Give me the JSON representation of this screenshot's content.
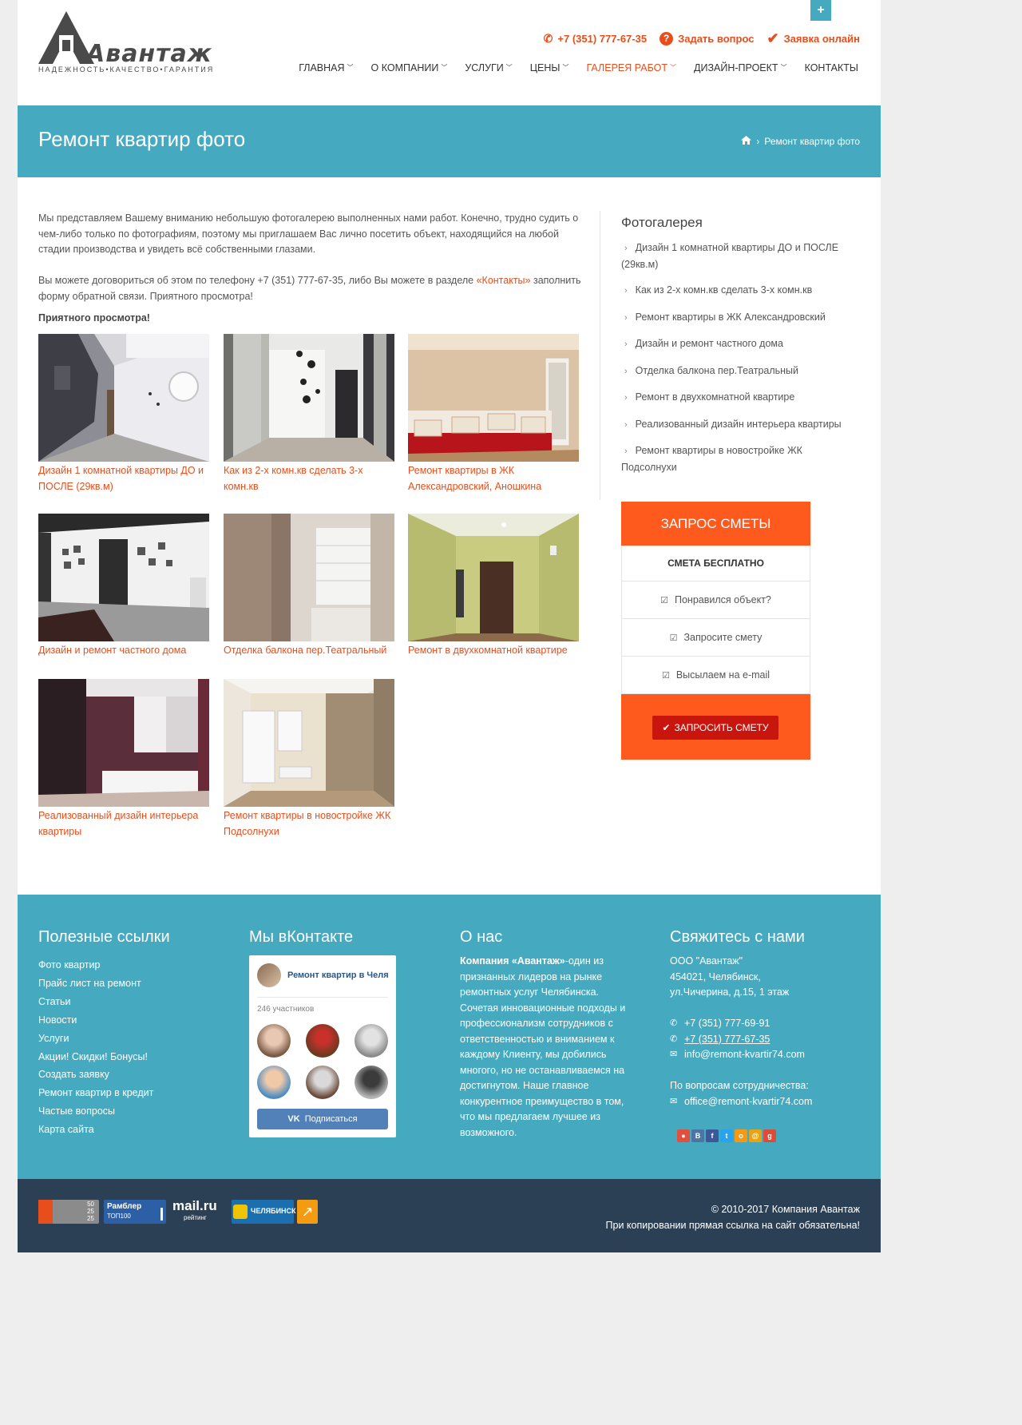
{
  "header": {
    "logo_brand": "Авантаж",
    "logo_tagline": "НАДЕЖНОСТЬ•КАЧЕСТВО•ГАРАНТИЯ",
    "phone": "+7 (351) 777-67-35",
    "ask_label": "Задать вопрос",
    "request_label": "Заявка онлайн",
    "plus_icon": "+",
    "nav": [
      {
        "label": "ГЛАВНАЯ",
        "caret": true
      },
      {
        "label": "О КОМПАНИИ",
        "caret": true
      },
      {
        "label": "УСЛУГИ",
        "caret": true
      },
      {
        "label": "ЦЕНЫ",
        "caret": true
      },
      {
        "label": "ГАЛЕРЕЯ РАБОТ",
        "caret": true,
        "active": true
      },
      {
        "label": "ДИЗАЙН-ПРОЕКТ",
        "caret": true
      },
      {
        "label": "КОНТАКТЫ",
        "caret": false
      }
    ]
  },
  "title_band": {
    "title": "Ремонт квартир фото",
    "breadcrumb_current": "Ремонт квартир фото"
  },
  "content": {
    "intro_p1": "Мы представляем Вашему вниманию небольшую фотогалерею выполненных нами работ. Конечно, трудно судить о чем-либо только по фотографиям, поэтому мы приглашаем Вас лично посетить объект, находящийся на любой стадии производства и увидеть всё собственными глазами.",
    "intro_p2_a": "Вы можете договориться об этом по телефону +7 (351) 777-67-35, либо Вы можете в разделе ",
    "intro_p2_link": "«Контакты»",
    "intro_p2_b": " заполнить форму обратной связи. Приятного просмотра!",
    "intro_strong": "Приятного просмотра!",
    "gallery": [
      {
        "caption": "Дизайн 1 комнатной квартиры ДО и ПОСЛЕ (29кв.м)"
      },
      {
        "caption": "Как из 2-х комн.кв сделать 3-х комн.кв"
      },
      {
        "caption": "Ремонт квартиры в ЖК Александровский, Аношкина"
      },
      {
        "caption": "Дизайн и ремонт частного дома"
      },
      {
        "caption": "Отделка балкона пер.Театральный"
      },
      {
        "caption": "Ремонт в двухкомнатной квартире"
      },
      {
        "caption": "Реализованный дизайн интерьера квартиры"
      },
      {
        "caption": "Ремонт квартиры в новостройке ЖК Подсолнухи"
      }
    ]
  },
  "sidebar": {
    "title": "Фотогалерея",
    "links": [
      "Дизайн 1 комнатной квартиры ДО и ПОСЛЕ (29кв.м)",
      "Как из 2-х комн.кв сделать 3-х комн.кв",
      "Ремонт квартиры в ЖК Александровский",
      "Дизайн и ремонт частного дома",
      "Отделка балкона пер.Театральный",
      "Ремонт в двухкомнатной квартире",
      "Реализованный дизайн интерьера квартиры",
      "Ремонт квартиры в новостройке ЖК Подсолнухи"
    ],
    "smeta": {
      "title": "ЗАПРОС СМЕТЫ",
      "free": "СМЕТА БЕСПЛАТНО",
      "items": [
        "Понравился объект?",
        "Запросите смету",
        "Высылаем на e-mail"
      ],
      "button": "ЗАПРОСИТЬ СМЕТУ"
    }
  },
  "footer": {
    "links_title": "Полезные ссылки",
    "links": [
      "Фото квартир",
      "Прайс лист на ремонт",
      "Статьи",
      "Новости",
      "Услуги",
      "Акции! Скидки! Бонусы!",
      "Создать заявку",
      "Ремонт квартир в кредит",
      "Частые вопросы",
      "Карта сайта"
    ],
    "vk_title": "Мы вКонтакте",
    "vk": {
      "group_name": "Ремонт квартир в Челябинске",
      "members": "246 участников",
      "subscribe": "Подписаться",
      "vk_logo": "VK"
    },
    "about_title": "О нас",
    "about_bold": "Компания «Авантаж»",
    "about_text": "-один из признанных лидеров на рынке ремонтных услуг Челябинска. Сочетая инновационные подходы и профессионализм сотрудников с ответственностью и вниманием к каждому Клиенту, мы добились многого, но не останавливаемся на достигнутом. Наше главное конкурентное преимущество в том, что мы предлагаем лучшее из возможного.",
    "contact_title": "Свяжитесь с нами",
    "company": "ООО \"Авантаж\"",
    "address1": "454021, Челябинск,",
    "address2": "ул.Чичерина, д.15, 1 этаж",
    "phone1": "+7 (351) 777-69-91",
    "phone2": "+7 (351) 777-67-35",
    "email1": "info@remont-kvartir74.com",
    "coop_label": "По вопросам сотрудничества:",
    "email2": "office@remont-kvartir74.com",
    "social": [
      "rss",
      "vk",
      "facebook",
      "twitter",
      "odnoklassniki",
      "mail",
      "google-plus"
    ]
  },
  "bottom": {
    "copyright": "© 2010-2017 Компания Авантаж",
    "copy_note": "При копировании прямая ссылка на сайт обязательна!",
    "counters": [
      {
        "name": "liveinternet",
        "lines": [
          "50",
          "25",
          "25"
        ]
      },
      {
        "name": "rambler",
        "text1": "Рамблер",
        "text2": "ТОП100"
      },
      {
        "name": "mailru",
        "text1": "mail.ru",
        "text2": "рейтинг"
      },
      {
        "name": "chelyabinsk",
        "text1": "ЧЕЛЯБИНСК"
      }
    ]
  },
  "colors": {
    "accent": "#e84e1b",
    "teal": "#45aabf",
    "smeta_orange": "#fe5a1d",
    "smeta_button": "#c8160e",
    "dark": "#2c4055"
  }
}
